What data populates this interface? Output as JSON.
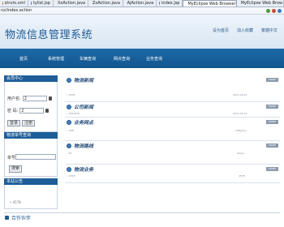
{
  "tabs": [
    {
      "label": "struts.xml",
      "icon": "xml-file-icon",
      "active": false
    },
    {
      "label": "tylist.jsp",
      "icon": "jsp-file-icon",
      "active": false
    },
    {
      "label": "XxAction.java",
      "icon": "java-file-icon",
      "active": false
    },
    {
      "label": "ZxAction.java",
      "icon": "java-file-icon",
      "active": false
    },
    {
      "label": "AjAction.java",
      "icon": "java-file-icon",
      "active": false
    },
    {
      "label": "index.jsp",
      "icon": "jsp-file-icon",
      "active": false
    },
    {
      "label": "MyEclipse Web Browser",
      "icon": "web-browser-icon",
      "active": true
    },
    {
      "label": "MyEclipse Web Brow",
      "icon": "web-browser-icon",
      "active": false
    }
  ],
  "address": {
    "url": "nz/index.action"
  },
  "header": {
    "logo": "物流信息管理系统",
    "links": [
      "设为首页",
      "加入收藏",
      "繁體中文"
    ]
  },
  "nav": {
    "home": "首页",
    "system": "系统管理",
    "fee": "车辆查询",
    "network": "网点查询",
    "business": "业务查询"
  },
  "login": {
    "title": "会员中心",
    "username_label": "用户名:",
    "username_value": "2",
    "password_label": "密  码:",
    "password_value": "2",
    "login_button": "登录",
    "register_button": "注册"
  },
  "track": {
    "title": "物流单号查询",
    "number_label": "单号:",
    "search_button": "搜索"
  },
  "notice": {
    "title": "本站公告",
    "item": "4578"
  },
  "sections": {
    "news": {
      "title": "物流新闻",
      "more": "MORE",
      "rows": [
        {
          "text": "4578",
          "date": "2013-03-23"
        }
      ]
    },
    "announcement": {
      "title": "公司新闻",
      "more": "MORE",
      "rows": [
        {
          "text": "2543535",
          "date": "2013-03-23"
        }
      ]
    },
    "outlets": {
      "title": "业务网点",
      "more": "MORE",
      "rows": [
        {
          "text": "dfdf",
          "col": "436yytry"
        }
      ]
    },
    "routes": {
      "title": "物流路线",
      "more": "MORE",
      "rows": [
        {
          "text": "67",
          "col": "rtutyu"
        }
      ]
    },
    "business": {
      "title": "物流业务",
      "more": "MORE",
      "rows": [
        {
          "text": "4578",
          "col": "4578"
        }
      ]
    }
  },
  "footer": {
    "cooperate": "合作伙伴"
  }
}
